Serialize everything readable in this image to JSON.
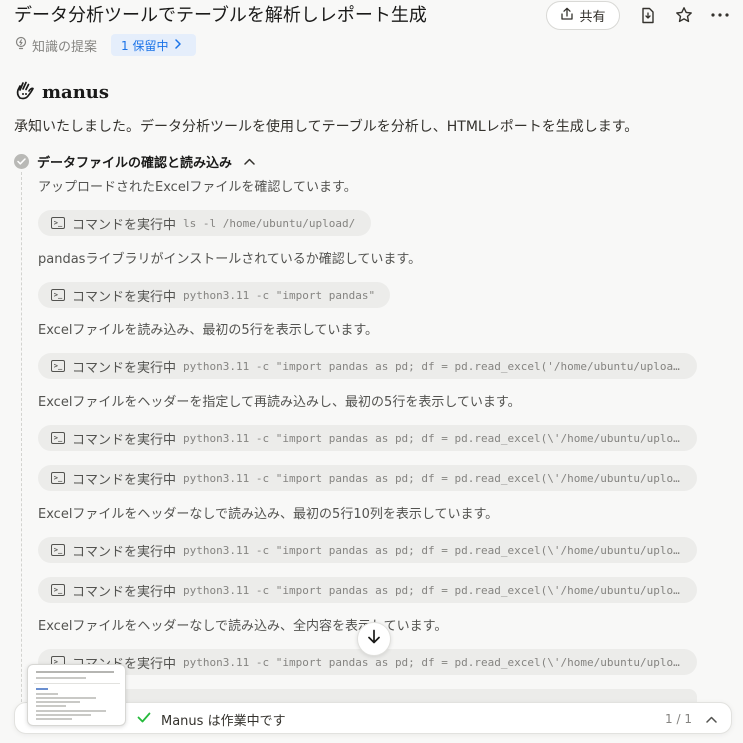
{
  "header": {
    "title": "データ分析ツールでテーブルを解析しレポート生成",
    "share_label": "共有",
    "knowledge_label": "知識の提案",
    "pending_badge": "1 保留中"
  },
  "icons": {
    "share": "upload-icon",
    "file": "file-icon",
    "star": "star-icon",
    "more": "more-icon",
    "knowledge": "lightbulb-icon"
  },
  "logo": {
    "text": "manus"
  },
  "intro": "承知いたしました。データ分析ツールを使用してテーブルを分析し、HTMLレポートを生成します。",
  "step": {
    "title": "データファイルの確認と読み込み",
    "descriptions": [
      "アップロードされたExcelファイルを確認しています。",
      "pandasライブラリがインストールされているか確認しています。",
      "Excelファイルを読み込み、最初の5行を表示しています。",
      "Excelファイルをヘッダーを指定して再読み込みし、最初の5行を表示しています。",
      "Excelファイルをヘッダーなしで読み込み、最初の5行10列を表示しています。",
      "Excelファイルをヘッダーなしで読み込み、全内容を表示しています。"
    ],
    "command_label": "コマンドを実行中",
    "commands": [
      "ls -l /home/ubuntu/upload/",
      "python3.11 -c \"import pandas\"",
      "python3.11 -c \"import pandas as pd; df = pd.read_excel('/home/ubuntu/upload/",
      "python3.11 -c \"import pandas as pd; df = pd.read_excel(\\'/home/ubuntu/upload/",
      "python3.11 -c \"import pandas as pd; df = pd.read_excel(\\'/home/ubuntu/upload/",
      "python3.11 -c \"import pandas as pd; df = pd.read_excel(\\'/home/ubuntu/upload/",
      "python3.11 -c \"import pandas as pd; df = pd.read_excel(\\'/home/ubuntu/upload/",
      "python3.11 -c \"import pandas as pd; df = pd.read_excel(\\'/home/ubuntu/upload/"
    ]
  },
  "status": {
    "text": "Manus は作業中です",
    "counter": "1 / 1"
  },
  "colors": {
    "accent": "#1a73e8",
    "success": "#25ba3b",
    "background": "#f8f8f7"
  }
}
